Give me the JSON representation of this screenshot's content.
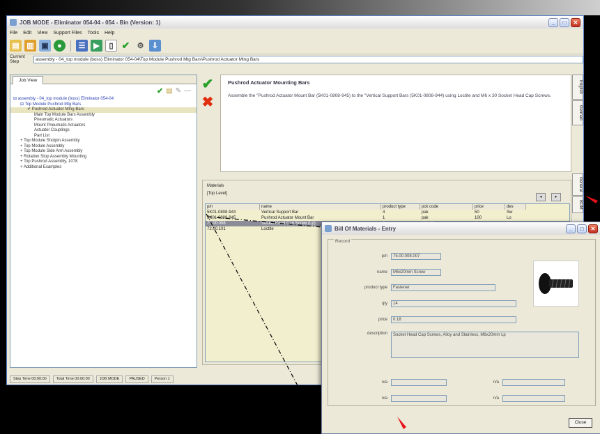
{
  "window": {
    "title": "JOB MODE - Eliminator 054-04 - 054 - Bin (Version: 1)",
    "menu": [
      "File",
      "Edit",
      "View",
      "Support Files",
      "Tools",
      "Help"
    ],
    "current_step_label": "Current Step",
    "current_step_value": "assembly - 04_top module (boss) Eliminator 054-04\\Top Module Pushrod Mtg Bars\\Pushrod Actuator Mtng Bars"
  },
  "tree": {
    "tab": "Job View",
    "items": [
      {
        "text": "⊟ assembly - 04_top module (boss) Eliminator 054-04",
        "indent": 0,
        "blue": true
      },
      {
        "text": "⊟ Top Module Pushrod Mtg Bars",
        "indent": 1,
        "blue": true
      },
      {
        "text": "✔ Pushrod Actuator Mtng Bars",
        "indent": 2,
        "selected": true
      },
      {
        "text": "Main Top Module Bars Assembly",
        "indent": 3
      },
      {
        "text": "Pneumatic Actuators",
        "indent": 3
      },
      {
        "text": "Mount Pneumatic Actuators",
        "indent": 3
      },
      {
        "text": "Actuator Couplings",
        "indent": 3
      },
      {
        "text": "Part List",
        "indent": 3
      },
      {
        "text": "+ Top Module Shotpin Assembly",
        "indent": 1
      },
      {
        "text": "+ Top Module Assembly",
        "indent": 1
      },
      {
        "text": "+ Top Module Side Arm Assembly",
        "indent": 1
      },
      {
        "text": "+ Rotation Stop Assembly Mounting",
        "indent": 1
      },
      {
        "text": "+ Top Pushrod Assembly, 1078",
        "indent": 1
      },
      {
        "text": "+ Additional Examples",
        "indent": 1
      }
    ]
  },
  "instruction": {
    "title": "Pushrod Actuator Mounting Bars",
    "body": "Assemble the \"Pushrod Actuator Mount Bar (5K01-0808-945) to the \"Vertical Support Bars (5K01-0808-944) using Loctite and M6 x 30 Socket Head Cap Screws."
  },
  "side_tabs": [
    "English",
    "German",
    "General",
    "BOM"
  ],
  "materials": {
    "label": "Materials",
    "level": "[Top Level]",
    "columns": [
      "p/n",
      "name",
      "product type",
      "pck code",
      "price",
      "des"
    ],
    "rows": [
      [
        "5K01-0808-944",
        "Vertical Support Bar",
        "4",
        "pak",
        "50",
        "Sw"
      ],
      [
        "5K01-0808-945",
        "Pushrod Actuator Mount Bar",
        "1",
        "pak",
        "100",
        "Lo"
      ],
      [
        "75.00.008",
        "Socket Head Cap Screw (Lp)",
        "6",
        "M6x20mm",
        "1",
        "Hea"
      ],
      [
        "72.00.101",
        "Loctite",
        "",
        "",
        "",
        ""
      ]
    ],
    "selected_row": 2
  },
  "status": [
    "Step Time 00:00:00",
    "Total Time 00:00:00",
    "JOB MODE",
    "PAUSED",
    "Person 1"
  ],
  "dialog": {
    "title": "Bill Of Materials - Entry",
    "group": "Record",
    "fields": [
      {
        "label": "p/n",
        "value": "75.00.008.007"
      },
      {
        "label": "name",
        "value": "M6x20mm Screw"
      },
      {
        "label": "product type",
        "value": "Fastener"
      },
      {
        "label": "qty",
        "value": "14"
      },
      {
        "label": "price",
        "value": "0.18"
      },
      {
        "label": "description",
        "value": "Socket Head Cap Screws, Alloy and Stainless, M6x20mm Lp"
      }
    ],
    "extra_labels": [
      "n/a",
      "n/a",
      "n/a",
      "n/a"
    ],
    "close": "Close"
  },
  "colors": {
    "accent_red": "#e8101a",
    "check_green": "#2aa02a",
    "selection": "#8c8c98"
  }
}
